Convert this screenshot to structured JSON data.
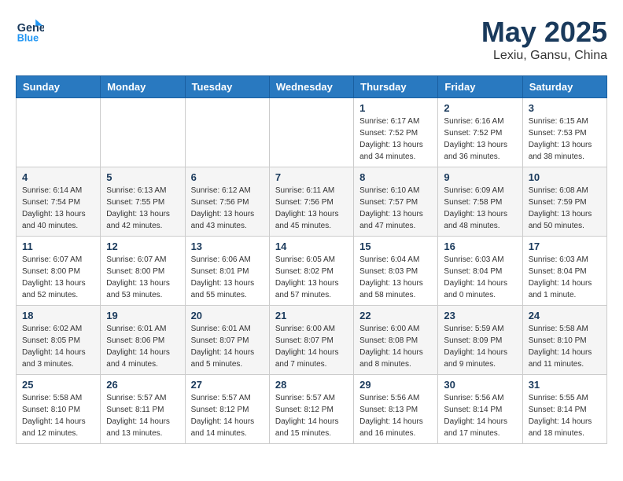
{
  "header": {
    "logo_line1": "General",
    "logo_line2": "Blue",
    "month": "May 2025",
    "location": "Lexiu, Gansu, China"
  },
  "weekdays": [
    "Sunday",
    "Monday",
    "Tuesday",
    "Wednesday",
    "Thursday",
    "Friday",
    "Saturday"
  ],
  "weeks": [
    [
      {
        "day": "",
        "info": ""
      },
      {
        "day": "",
        "info": ""
      },
      {
        "day": "",
        "info": ""
      },
      {
        "day": "",
        "info": ""
      },
      {
        "day": "1",
        "info": "Sunrise: 6:17 AM\nSunset: 7:52 PM\nDaylight: 13 hours\nand 34 minutes."
      },
      {
        "day": "2",
        "info": "Sunrise: 6:16 AM\nSunset: 7:52 PM\nDaylight: 13 hours\nand 36 minutes."
      },
      {
        "day": "3",
        "info": "Sunrise: 6:15 AM\nSunset: 7:53 PM\nDaylight: 13 hours\nand 38 minutes."
      }
    ],
    [
      {
        "day": "4",
        "info": "Sunrise: 6:14 AM\nSunset: 7:54 PM\nDaylight: 13 hours\nand 40 minutes."
      },
      {
        "day": "5",
        "info": "Sunrise: 6:13 AM\nSunset: 7:55 PM\nDaylight: 13 hours\nand 42 minutes."
      },
      {
        "day": "6",
        "info": "Sunrise: 6:12 AM\nSunset: 7:56 PM\nDaylight: 13 hours\nand 43 minutes."
      },
      {
        "day": "7",
        "info": "Sunrise: 6:11 AM\nSunset: 7:56 PM\nDaylight: 13 hours\nand 45 minutes."
      },
      {
        "day": "8",
        "info": "Sunrise: 6:10 AM\nSunset: 7:57 PM\nDaylight: 13 hours\nand 47 minutes."
      },
      {
        "day": "9",
        "info": "Sunrise: 6:09 AM\nSunset: 7:58 PM\nDaylight: 13 hours\nand 48 minutes."
      },
      {
        "day": "10",
        "info": "Sunrise: 6:08 AM\nSunset: 7:59 PM\nDaylight: 13 hours\nand 50 minutes."
      }
    ],
    [
      {
        "day": "11",
        "info": "Sunrise: 6:07 AM\nSunset: 8:00 PM\nDaylight: 13 hours\nand 52 minutes."
      },
      {
        "day": "12",
        "info": "Sunrise: 6:07 AM\nSunset: 8:00 PM\nDaylight: 13 hours\nand 53 minutes."
      },
      {
        "day": "13",
        "info": "Sunrise: 6:06 AM\nSunset: 8:01 PM\nDaylight: 13 hours\nand 55 minutes."
      },
      {
        "day": "14",
        "info": "Sunrise: 6:05 AM\nSunset: 8:02 PM\nDaylight: 13 hours\nand 57 minutes."
      },
      {
        "day": "15",
        "info": "Sunrise: 6:04 AM\nSunset: 8:03 PM\nDaylight: 13 hours\nand 58 minutes."
      },
      {
        "day": "16",
        "info": "Sunrise: 6:03 AM\nSunset: 8:04 PM\nDaylight: 14 hours\nand 0 minutes."
      },
      {
        "day": "17",
        "info": "Sunrise: 6:03 AM\nSunset: 8:04 PM\nDaylight: 14 hours\nand 1 minute."
      }
    ],
    [
      {
        "day": "18",
        "info": "Sunrise: 6:02 AM\nSunset: 8:05 PM\nDaylight: 14 hours\nand 3 minutes."
      },
      {
        "day": "19",
        "info": "Sunrise: 6:01 AM\nSunset: 8:06 PM\nDaylight: 14 hours\nand 4 minutes."
      },
      {
        "day": "20",
        "info": "Sunrise: 6:01 AM\nSunset: 8:07 PM\nDaylight: 14 hours\nand 5 minutes."
      },
      {
        "day": "21",
        "info": "Sunrise: 6:00 AM\nSunset: 8:07 PM\nDaylight: 14 hours\nand 7 minutes."
      },
      {
        "day": "22",
        "info": "Sunrise: 6:00 AM\nSunset: 8:08 PM\nDaylight: 14 hours\nand 8 minutes."
      },
      {
        "day": "23",
        "info": "Sunrise: 5:59 AM\nSunset: 8:09 PM\nDaylight: 14 hours\nand 9 minutes."
      },
      {
        "day": "24",
        "info": "Sunrise: 5:58 AM\nSunset: 8:10 PM\nDaylight: 14 hours\nand 11 minutes."
      }
    ],
    [
      {
        "day": "25",
        "info": "Sunrise: 5:58 AM\nSunset: 8:10 PM\nDaylight: 14 hours\nand 12 minutes."
      },
      {
        "day": "26",
        "info": "Sunrise: 5:57 AM\nSunset: 8:11 PM\nDaylight: 14 hours\nand 13 minutes."
      },
      {
        "day": "27",
        "info": "Sunrise: 5:57 AM\nSunset: 8:12 PM\nDaylight: 14 hours\nand 14 minutes."
      },
      {
        "day": "28",
        "info": "Sunrise: 5:57 AM\nSunset: 8:12 PM\nDaylight: 14 hours\nand 15 minutes."
      },
      {
        "day": "29",
        "info": "Sunrise: 5:56 AM\nSunset: 8:13 PM\nDaylight: 14 hours\nand 16 minutes."
      },
      {
        "day": "30",
        "info": "Sunrise: 5:56 AM\nSunset: 8:14 PM\nDaylight: 14 hours\nand 17 minutes."
      },
      {
        "day": "31",
        "info": "Sunrise: 5:55 AM\nSunset: 8:14 PM\nDaylight: 14 hours\nand 18 minutes."
      }
    ]
  ]
}
